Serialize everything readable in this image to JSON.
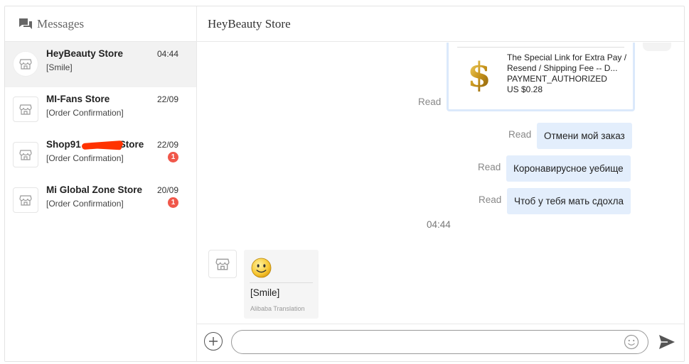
{
  "sidebar": {
    "title": "Messages",
    "conversations": [
      {
        "name": "HeyBeauty Store",
        "time": "04:44",
        "preview": "[Smile]",
        "badge": ""
      },
      {
        "name": "MI-Fans Store",
        "time": "22/09",
        "preview": "[Order Confirmation]",
        "badge": ""
      },
      {
        "name": "Shop91",
        "name_suffix": "Store",
        "time": "22/09",
        "preview": "[Order Confirmation]",
        "badge": "1"
      },
      {
        "name": "Mi Global Zone Store",
        "time": "20/09",
        "preview": "[Order Confirmation]",
        "badge": "1"
      }
    ]
  },
  "chat": {
    "title": "HeyBeauty Store",
    "order_card": {
      "title": "The Special Link for Extra Pay / Resend / Shipping Fee -- D...",
      "status": "PAYMENT_AUTHORIZED",
      "price": "US $0.28",
      "read": "Read"
    },
    "outgoing": [
      {
        "text": "Отмени мой заказ",
        "read": "Read"
      },
      {
        "text": "Коронавирусное уебище",
        "read": "Read"
      },
      {
        "text": "Чтоб у тебя мать сдохла",
        "read": "Read"
      }
    ],
    "time_separator": "04:44",
    "incoming": {
      "text": "[Smile]",
      "translation": "Alibaba Translation"
    }
  },
  "input": {
    "placeholder": "",
    "value": ""
  },
  "colors": {
    "bubble": "#e3eefc",
    "badge": "#f0574a",
    "active_row": "#f2f2f2"
  }
}
